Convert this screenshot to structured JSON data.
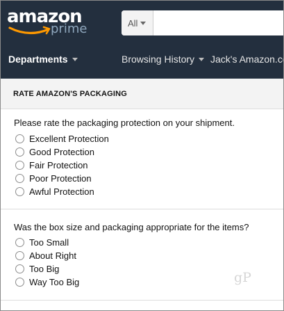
{
  "header": {
    "logo_primary": "amazon",
    "logo_secondary": "prime",
    "search": {
      "category": "All",
      "value": "",
      "placeholder": ""
    },
    "nav": {
      "departments": "Departments",
      "browsing_history": "Browsing History",
      "account": "Jack's Amazon.co"
    }
  },
  "section": {
    "title": "RATE AMAZON'S PACKAGING"
  },
  "question1": {
    "text": "Please rate the packaging protection on your shipment.",
    "options": [
      "Excellent Protection",
      "Good Protection",
      "Fair Protection",
      "Poor Protection",
      "Awful Protection"
    ]
  },
  "question2": {
    "text": "Was the box size and packaging appropriate for the items?",
    "options": [
      "Too Small",
      "About Right",
      "Too Big",
      "Way Too Big"
    ]
  },
  "watermark": "gP",
  "colors": {
    "header_bg": "#232f3e",
    "smile": "#f90",
    "section_bg": "#f3f3f3"
  }
}
